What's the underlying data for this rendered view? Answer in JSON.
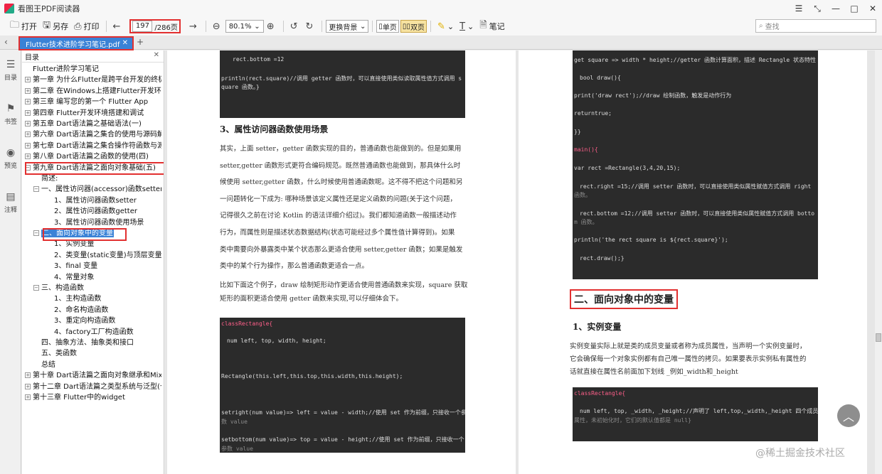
{
  "titlebar": {
    "title": "看图王PDF阅读器",
    "controls": [
      "☰",
      "⤡",
      "—",
      "□",
      "✕"
    ]
  },
  "toolbar": {
    "open": "打开",
    "save": "另存",
    "print": "打印",
    "page_current": "197",
    "page_total": "/286页",
    "zoom": "80.1%",
    "background": "更换背景",
    "single_page": "单页",
    "double_page": "双页",
    "notes": "笔记",
    "search_placeholder": "查找"
  },
  "tabs": [
    {
      "label": "Flutter技术进阶学习笔记.pdf"
    }
  ],
  "leftbar": {
    "items": [
      "目录",
      "书签",
      "预览",
      "注释"
    ]
  },
  "toc": {
    "header": "目录",
    "items": [
      {
        "text": "Flutter进阶学习笔记",
        "level": 0,
        "pm": ""
      },
      {
        "text": "第一章 为什么Flutter是跨平台开发的终极之选",
        "level": 0,
        "pm": "+"
      },
      {
        "text": "第二章 在Windows上搭建Flutter开发环境",
        "level": 0,
        "pm": "+"
      },
      {
        "text": "第三章 编写您的第一个 Flutter App",
        "level": 0,
        "pm": "+"
      },
      {
        "text": "第四章 Flutter开发环境搭建和调试",
        "level": 0,
        "pm": "+"
      },
      {
        "text": "第五章 Dart语法篇之基础语法(一)",
        "level": 0,
        "pm": "+"
      },
      {
        "text": "第六章 Dart语法篇之集合的使用与源码解析(二)",
        "level": 0,
        "pm": "+"
      },
      {
        "text": "第七章 Dart语法篇之集合操作符函数与源码分析",
        "level": 0,
        "pm": "+"
      },
      {
        "text": "第八章 Dart语法篇之函数的使用(四)",
        "level": 0,
        "pm": "+"
      },
      {
        "text": "第九章 Dart语法篇之面向对象基础(五)",
        "level": 0,
        "pm": "−"
      },
      {
        "text": "简述:",
        "level": 1,
        "pm": ""
      },
      {
        "text": "一、属性访问器(accessor)函数setter和getter",
        "level": 1,
        "pm": "−"
      },
      {
        "text": "1、属性访问器函数setter",
        "level": 2,
        "pm": ""
      },
      {
        "text": "2、属性访问器函数getter",
        "level": 2,
        "pm": ""
      },
      {
        "text": "3、属性访问器函数使用场景",
        "level": 2,
        "pm": ""
      },
      {
        "text": "二、面向对象中的变量",
        "level": 1,
        "pm": "−"
      },
      {
        "text": "1、实例变量",
        "level": 2,
        "pm": ""
      },
      {
        "text": "2、类变量(static变量)与顶层变量",
        "level": 2,
        "pm": ""
      },
      {
        "text": "3、final 变量",
        "level": 2,
        "pm": ""
      },
      {
        "text": "4、常量对象",
        "level": 2,
        "pm": ""
      },
      {
        "text": "三、构造函数",
        "level": 1,
        "pm": "−"
      },
      {
        "text": "1、主构造函数",
        "level": 2,
        "pm": ""
      },
      {
        "text": "2、命名构造函数",
        "level": 2,
        "pm": ""
      },
      {
        "text": "3、重定向构造函数",
        "level": 2,
        "pm": ""
      },
      {
        "text": "4、factory工厂构造函数",
        "level": 2,
        "pm": ""
      },
      {
        "text": "四、抽象方法、抽象类和接口",
        "level": 1,
        "pm": ""
      },
      {
        "text": "五、类函数",
        "level": 1,
        "pm": ""
      },
      {
        "text": "总结",
        "level": 1,
        "pm": ""
      },
      {
        "text": "第十章 Dart语法篇之面向对象继承和Mixins",
        "level": 0,
        "pm": "+"
      },
      {
        "text": "第十二章 Dart语法篇之类型系统与泛型(七)",
        "level": 0,
        "pm": "+"
      },
      {
        "text": "第十三章 Flutter中的widget",
        "level": 0,
        "pm": "+"
      }
    ]
  },
  "left_page": {
    "code1": [
      "rect.bottom =12",
      "println(rect.square)//调用 getter 函数时，可以直接使用类似读取属性值方式调用 s",
      "quare 函数。}"
    ],
    "heading": "3、属性访问器函数使用场景",
    "paragraph1": [
      "其实，上面 setter，getter 函数实现的目的，普通函数也能做到的。但是如果用",
      "setter,getter 函数形式更符合编码规范。既然普通函数也能做到，那具体什么时",
      "候使用 setter,getter 函数，什么时候使用普通函数呢。这不得不把这个问题和另",
      "一问题转化一下成为: 哪种场景该定义属性还是定义函数的问题(关于这个问题，",
      "记得很久之前在讨论 Kotlin 的语法详细介绍过)。我们都知道函数一般描述动作",
      "行为，而属性则是描述状态数据结构(状态可能经过多个属性值计算得到)。如果",
      "类中需要向外暴露类中某个状态那么更适合使用 setter,getter 函数；如果是触发",
      "类中的某个行为操作，那么普通函数更适合一点。"
    ],
    "paragraph2": [
      "比如下面这个例子，draw 绘制矩形动作更适合使用普通函数来实现，square 获取",
      "矩形的面积更适合使用 getter 函数来实现,可以仔细体会下。"
    ],
    "code2": [
      "classRectangle{",
      "num left, top, width, height;",
      "Rectangle(this.left,this.top,this.width,this.height);",
      "setright(num value)=> left = value - width;//使用 set 作为前缀，只接收一个参",
      "数 value",
      "setbottom(num value)=> top = value - height;//使用 set 作为前缀，只接收一个",
      "参数 value"
    ]
  },
  "right_page": {
    "code1": [
      "get square => width * height;//getter 函数计算面积，描述 Rectangle 状态特性",
      "bool draw(){",
      "print('draw rect');//draw 绘制函数，触发是动作行为",
      "returntrue;",
      "}}",
      "main(){",
      "var rect =Rectangle(3,4,20,15);",
      "rect.right =15;//调用 setter 函数时，可以直接使用类似属性赋值方式调用 right",
      "函数。",
      "rect.bottom =12;//调用 setter 函数时，可以直接使用类似属性赋值方式调用 botto",
      "m 函数。",
      "println('the rect square is ${rect.square}');",
      "rect.draw();}"
    ],
    "heading": "二、面向对象中的变量",
    "subheading": "1、实例变量",
    "paragraph": [
      "实例变量实际上就是类的成员变量或者称为成员属性，当声明一个实例变量时，",
      "它会确保每一个对象实例都有自己唯一属性的拷贝。如果要表示实例私有属性的",
      "话就直接在属性名前面加下划线 _例如_width和_height"
    ],
    "code2": [
      "classRectangle{",
      "num left, top, _width, _height;//声明了 left,top,_width,_height 四个成员",
      "属性，未初始化时，它们的默认值都是 null}"
    ]
  },
  "watermark": "@稀土掘金技术社区",
  "colors": {
    "accent": "#3a82d6",
    "highlight": "#e23030",
    "code_bg": "#2b2b2b"
  }
}
